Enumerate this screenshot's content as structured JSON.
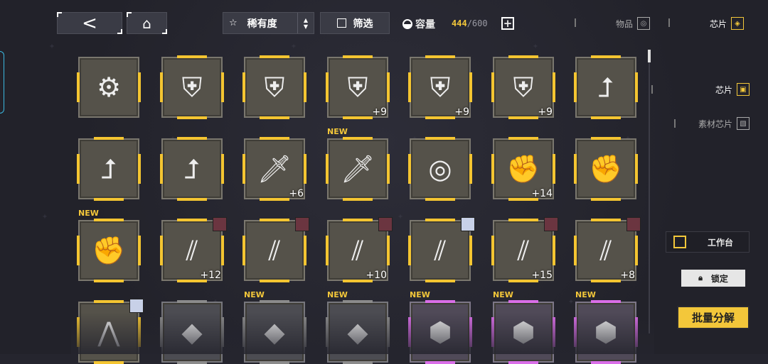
{
  "topbar": {
    "back_icon": "chevron-left-icon",
    "home_icon": "home-icon",
    "sort_label": "稀有度",
    "filter_label": "筛选",
    "capacity_label": "容量",
    "capacity_current": "444",
    "capacity_max": "/600",
    "tabs": [
      {
        "label": "物品"
      },
      {
        "label": "芯片"
      }
    ]
  },
  "side": {
    "tabs": [
      {
        "label": "芯片"
      },
      {
        "label": "素材芯片"
      }
    ],
    "workbench_label": "工作台",
    "lock_label": "锁定",
    "batch_label": "批量分解"
  },
  "items": [
    {
      "icon": "chainsaw-icon",
      "color": "gold",
      "plus": "",
      "new": false,
      "avatar": "",
      "glyph": "⚙"
    },
    {
      "icon": "sword-shield-icon",
      "color": "gold",
      "plus": "",
      "new": false,
      "avatar": "",
      "glyph": "⛨"
    },
    {
      "icon": "sword-shield-icon",
      "color": "gold",
      "plus": "",
      "new": false,
      "avatar": "",
      "glyph": "⛨"
    },
    {
      "icon": "sword-shield-icon",
      "color": "gold",
      "plus": "+9",
      "new": false,
      "avatar": "",
      "glyph": "⛨"
    },
    {
      "icon": "sword-shield-icon",
      "color": "gold",
      "plus": "+9",
      "new": false,
      "avatar": "",
      "glyph": "⛨"
    },
    {
      "icon": "sword-shield-icon",
      "color": "gold",
      "plus": "+9",
      "new": false,
      "avatar": "",
      "glyph": "⛨"
    },
    {
      "icon": "turn-arrow-icon",
      "color": "gold",
      "plus": "",
      "new": false,
      "avatar": "",
      "glyph": "⮥"
    },
    {
      "icon": "turn-arrow-icon",
      "color": "gold",
      "plus": "",
      "new": false,
      "avatar": "",
      "glyph": "⮥"
    },
    {
      "icon": "turn-arrow-icon",
      "color": "gold",
      "plus": "",
      "new": false,
      "avatar": "",
      "glyph": "⮥"
    },
    {
      "icon": "blade-icon",
      "color": "gold",
      "plus": "+6",
      "new": false,
      "avatar": "",
      "glyph": "🗡"
    },
    {
      "icon": "blade-icon",
      "color": "gold",
      "plus": "",
      "new": true,
      "avatar": "",
      "glyph": "🗡"
    },
    {
      "icon": "target-icon",
      "color": "gold",
      "plus": "",
      "new": false,
      "avatar": "",
      "glyph": "◎"
    },
    {
      "icon": "fist-icon",
      "color": "gold",
      "plus": "+14",
      "new": false,
      "avatar": "",
      "glyph": "✊"
    },
    {
      "icon": "fist-icon",
      "color": "gold",
      "plus": "",
      "new": false,
      "avatar": "",
      "glyph": "✊"
    },
    {
      "icon": "fist-icon",
      "color": "gold",
      "plus": "",
      "new": true,
      "avatar": "",
      "glyph": "✊"
    },
    {
      "icon": "claw-icon",
      "color": "gold",
      "plus": "+12",
      "new": false,
      "avatar": "red",
      "glyph": "⫽"
    },
    {
      "icon": "claw-icon",
      "color": "gold",
      "plus": "",
      "new": false,
      "avatar": "red",
      "glyph": "⫽"
    },
    {
      "icon": "claw-icon",
      "color": "gold",
      "plus": "+10",
      "new": false,
      "avatar": "red",
      "glyph": "⫽"
    },
    {
      "icon": "claw-icon",
      "color": "gold",
      "plus": "",
      "new": false,
      "avatar": "light",
      "glyph": "⫽"
    },
    {
      "icon": "claw-icon",
      "color": "gold",
      "plus": "+15",
      "new": false,
      "avatar": "red",
      "glyph": "⫽"
    },
    {
      "icon": "claw-icon",
      "color": "gold",
      "plus": "+8",
      "new": false,
      "avatar": "red",
      "glyph": "⫽"
    },
    {
      "icon": "spike-icon",
      "color": "gold",
      "plus": "",
      "new": false,
      "avatar": "light",
      "glyph": "⋀"
    },
    {
      "icon": "shard-icon",
      "color": "gray",
      "plus": "",
      "new": false,
      "avatar": "",
      "glyph": "◆"
    },
    {
      "icon": "shard-icon",
      "color": "gray",
      "plus": "",
      "new": true,
      "avatar": "",
      "glyph": "◆"
    },
    {
      "icon": "shard-icon",
      "color": "gray",
      "plus": "",
      "new": true,
      "avatar": "",
      "glyph": "◆"
    },
    {
      "icon": "crystal-icon",
      "color": "purple",
      "plus": "",
      "new": true,
      "avatar": "",
      "glyph": "⬢"
    },
    {
      "icon": "crystal-icon",
      "color": "purple",
      "plus": "",
      "new": true,
      "avatar": "",
      "glyph": "⬢"
    },
    {
      "icon": "crystal-icon",
      "color": "purple",
      "plus": "",
      "new": true,
      "avatar": "",
      "glyph": "⬢"
    }
  ],
  "new_label": "NEW"
}
